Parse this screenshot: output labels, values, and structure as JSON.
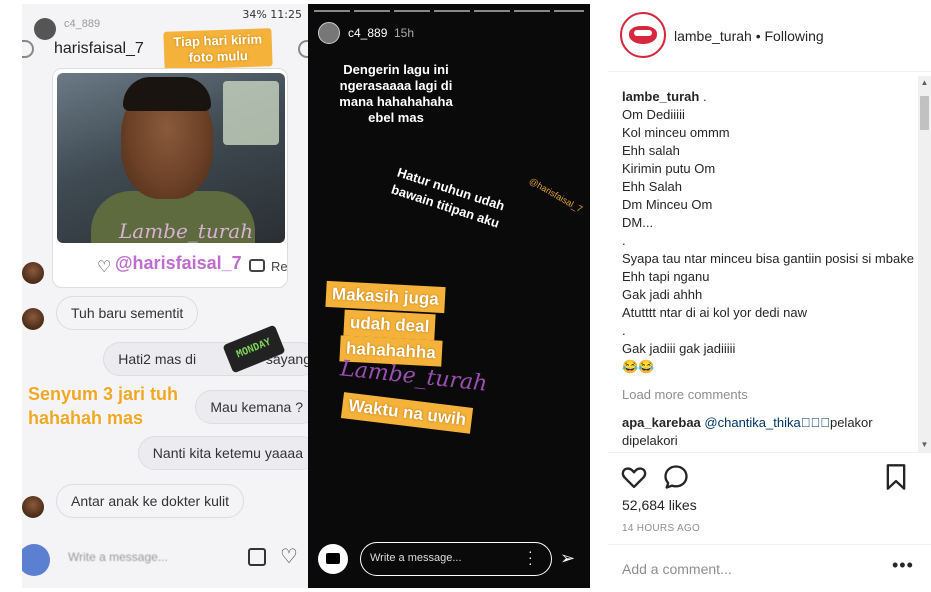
{
  "chat_screenshot": {
    "status_bar": "34% 11:25",
    "top_username": "c4_889",
    "chat_name": "harisfaisal_7",
    "sticker_top": "Tiap hari kirim foto mulu",
    "watermark": "Lambe_turah",
    "mention": "@harisfaisal_7",
    "reply_label": "Reply",
    "messages": [
      "Tuh baru sementit",
      "Hati2 mas di",
      "sayang",
      "Mau kemana ?",
      "Nanti kita ketemu yaaaa",
      "Antar anak ke dokter kulit"
    ],
    "sticker_senyum": "Senyum 3 jari tuh hahahah mas",
    "monday_sticker": "MONDAY",
    "message_placeholder": "Write a message..."
  },
  "story": {
    "username": "c4_889",
    "time": "15h",
    "text_1": "Dengerin lagu ini ngerasaaaa lagi di mana hahahahaha ebel mas",
    "text_2": "Hatur nuhun udah bawain titipan aku",
    "tag": "@harisfaisal_7",
    "highlight_1": "Makasih juga",
    "highlight_2": "udah deal",
    "highlight_3": "hahahahha",
    "watermark": "Lambe_turah",
    "highlight_4": "Waktu na uwih",
    "message_placeholder": "Write a message..."
  },
  "post": {
    "username": "lambe_turah",
    "follow_status": "• Following",
    "caption_author": "lambe_turah",
    "caption_lines": [
      ".",
      "Om Dediiiii",
      "Kol minceu ommm",
      "Ehh salah",
      "Kirimin putu Om",
      "Ehh Salah",
      "Dm Minceu Om",
      "DM...",
      ".",
      "Syapa tau ntar minceu bisa gantiin posisi si mbake",
      "Ehh tapi nganu",
      "Gak jadi ahhh",
      "Atutttt ntar di ai kol yor dedi naw",
      ".",
      "Gak jadiii gak jadiiiii",
      "😂😂"
    ],
    "load_more": "Load more comments",
    "comment_author": "apa_karebaa",
    "comment_mention": "@chantika_thika",
    "comment_text": "🏻🏻🏻pelakor dipelakori",
    "likes": "52,684 likes",
    "time_ago": "14 HOURS AGO",
    "add_comment_placeholder": "Add a comment...",
    "more_options": "•••"
  },
  "icons": {
    "like": "heart-icon",
    "comment": "comment-icon",
    "save": "bookmark-icon",
    "camera": "camera-icon",
    "send": "send-icon"
  },
  "colors": {
    "accent_orange": "#f4b23a",
    "brand_red": "#d7263d",
    "mention_blue": "#003569"
  }
}
